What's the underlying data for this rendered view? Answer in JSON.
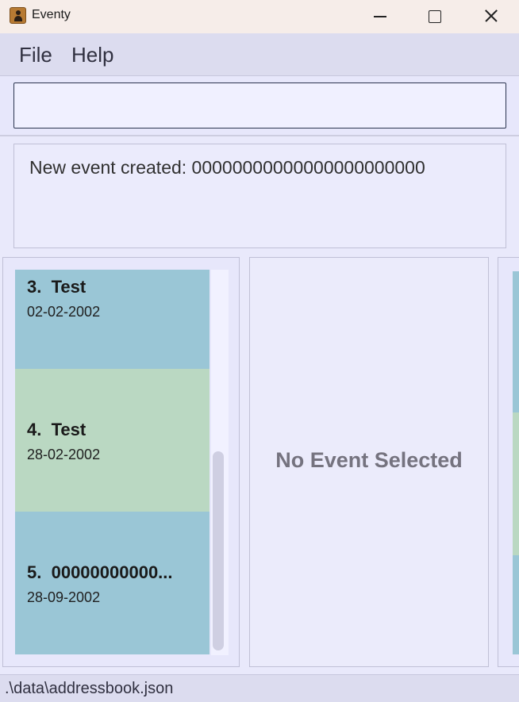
{
  "window": {
    "title": "Eventy",
    "icon": "address-book-icon"
  },
  "menu": {
    "items": [
      {
        "label": "File"
      },
      {
        "label": "Help"
      }
    ]
  },
  "command": {
    "value": "",
    "placeholder": ""
  },
  "result": {
    "message": "New event created: 00000000000000000000000"
  },
  "events": [
    {
      "index": "3.",
      "name": "Test",
      "date": "02-02-2002",
      "color": "#9ac6d6"
    },
    {
      "index": "4.",
      "name": "Test",
      "date": "28-02-2002",
      "color": "#bad8c2"
    },
    {
      "index": "5.",
      "name": "00000000000...",
      "date": "28-09-2002",
      "color": "#9ac6d6"
    }
  ],
  "detail": {
    "empty_message": "No Event Selected"
  },
  "status": {
    "file_path": ".\\data\\addressbook.json"
  },
  "colors": {
    "card_blue": "#9ac6d6",
    "card_green": "#bad8c2",
    "panel_bg": "#e7e7fb",
    "menubar_bg": "#dcdcef"
  }
}
